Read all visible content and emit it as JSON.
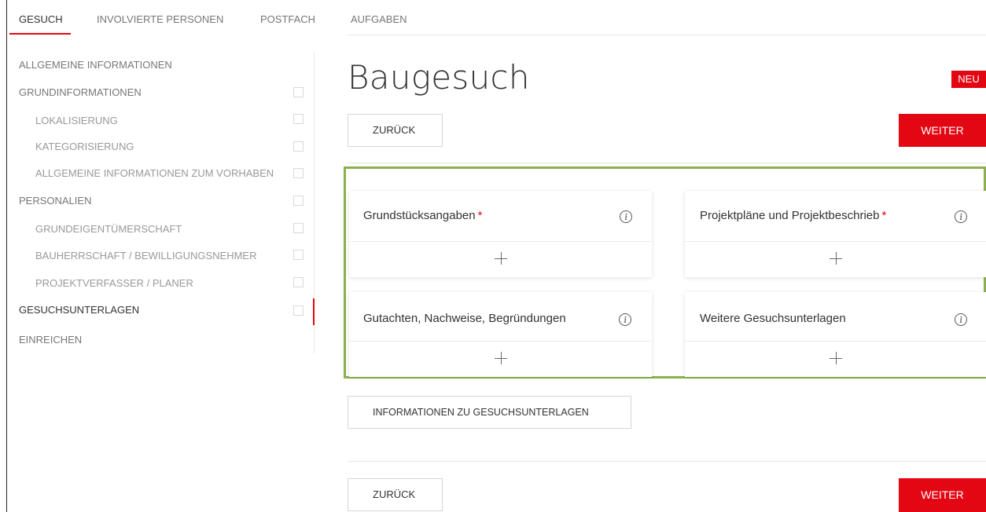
{
  "tabs": [
    {
      "label": "GESUCH"
    },
    {
      "label": "INVOLVIERTE PERSONEN"
    },
    {
      "label": "POSTFACH"
    },
    {
      "label": "AUFGABEN"
    }
  ],
  "sidebar": {
    "items": [
      {
        "label": "ALLGEMEINE INFORMATIONEN"
      },
      {
        "label": "GRUNDINFORMATIONEN"
      },
      {
        "label": "LOKALISIERUNG"
      },
      {
        "label": "KATEGORISIERUNG"
      },
      {
        "label": "ALLGEMEINE INFORMATIONEN ZUM VORHABEN"
      },
      {
        "label": "PERSONALIEN"
      },
      {
        "label": "GRUNDEIGENTÜMERSCHAFT"
      },
      {
        "label": "BAUHERRSCHAFT / BEWILLIGUNGSNEHMER"
      },
      {
        "label": "PROJEKTVERFASSER / PLANER"
      },
      {
        "label": "GESUCHSUNTERLAGEN"
      },
      {
        "label": "EINREICHEN"
      }
    ]
  },
  "main": {
    "title": "Baugesuch",
    "badge": "NEU",
    "back_label": "ZURÜCK",
    "next_label": "WEITER",
    "info_button_label": "INFORMATIONEN ZU GESUCHSUNTERLAGEN",
    "cards": [
      {
        "title": "Grundstücksangaben",
        "required": "*"
      },
      {
        "title": "Projektpläne und Projektbeschrieb",
        "required": "*"
      },
      {
        "title": "Gutachten, Nachweise, Begründungen"
      },
      {
        "title": "Weitere Gesuchsunterlagen"
      }
    ]
  },
  "colors": {
    "accent": "#e30613",
    "highlight_border": "#8bb04c"
  },
  "icons": {
    "info": "info-circle-icon",
    "add": "plus-icon"
  }
}
